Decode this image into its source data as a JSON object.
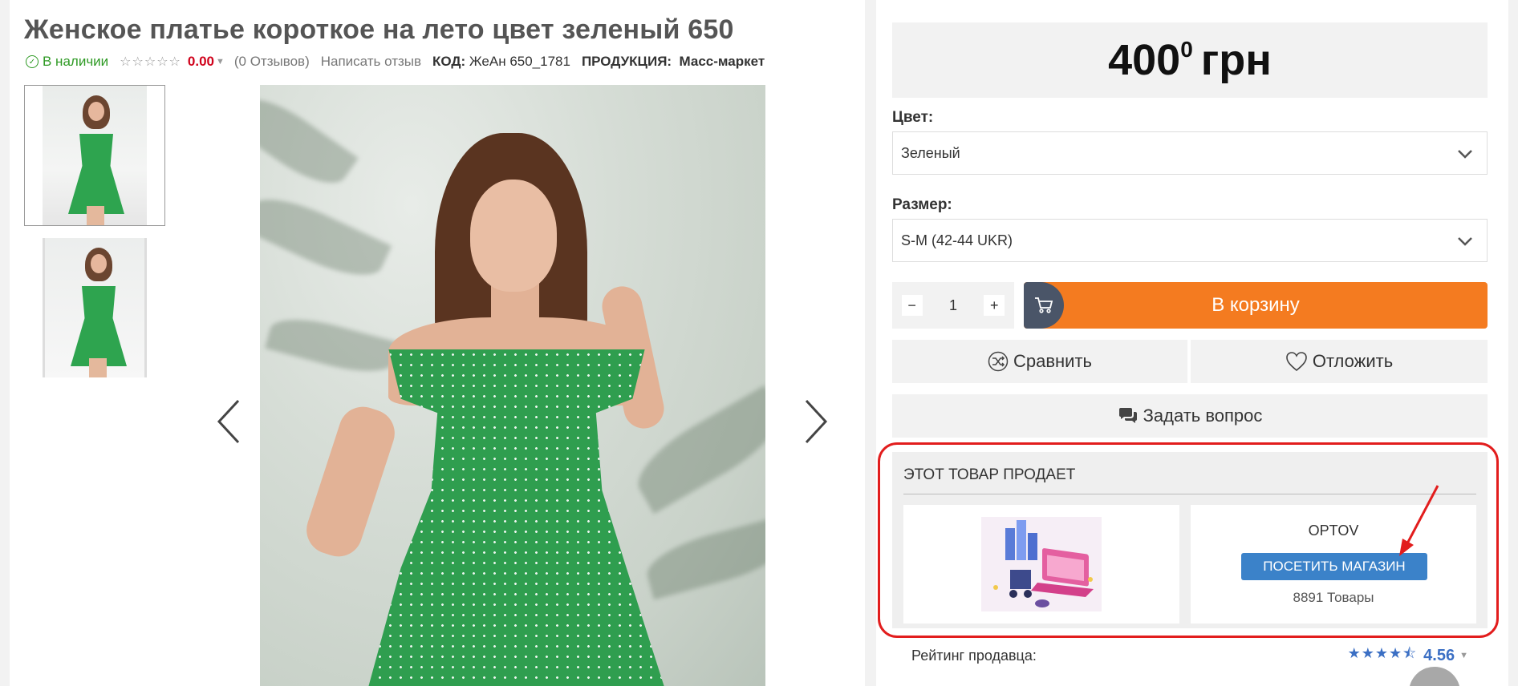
{
  "product": {
    "title": "Женское платье короткое на лето цвет зеленый 650",
    "stock_status": "В наличии",
    "stars": "☆☆☆☆☆",
    "rating_value": "0.00",
    "reviews_count": "(0 Отзывов)",
    "write_review": "Написать отзыв",
    "code_label": "КОД:",
    "code_value": "ЖеАн 650_1781",
    "production_label": "ПРОДУКЦИЯ:",
    "production_value": "Масс-маркет"
  },
  "gallery": {
    "thumbnail_count": 2,
    "active_index": 0
  },
  "price": {
    "main": "400",
    "cents": "0",
    "currency": "грн"
  },
  "options": {
    "color_label": "Цвет:",
    "color_value": "Зеленый",
    "size_label": "Размер:",
    "size_value": "S-M (42-44 UKR)"
  },
  "quantity": {
    "minus": "−",
    "value": "1",
    "plus": "+"
  },
  "actions": {
    "add_to_cart": "В корзину",
    "compare": "Сравнить",
    "wishlist": "Отложить",
    "ask_question": "Задать вопрос"
  },
  "seller": {
    "section_title": "ЭТОТ ТОВАР ПРОДАЕТ",
    "name": "OPTOV",
    "visit_button": "ПОСЕТИТЬ МАГАЗИН",
    "goods_count": "8891 Товары",
    "rating_label": "Рейтинг продавца:",
    "rating_stars": "★★★★⯪",
    "rating_value": "4.56"
  },
  "colors": {
    "accent_orange": "#f47b20",
    "button_blue": "#3b82c9",
    "in_stock_green": "#2e9a24",
    "rating_red": "#d0021b",
    "annotation_red": "#e21d1d"
  }
}
